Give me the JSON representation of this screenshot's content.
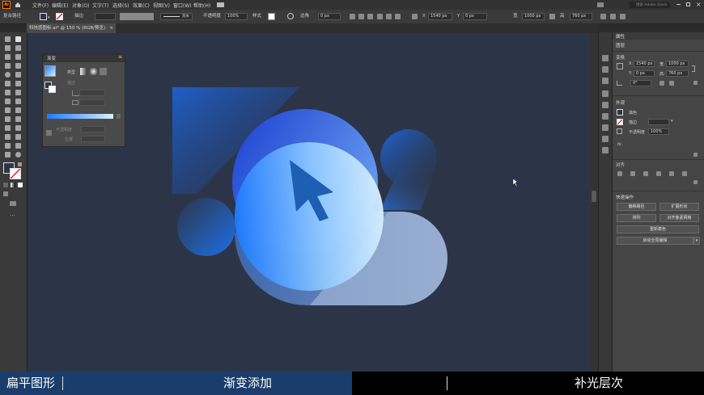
{
  "app": {
    "logo": "Ai"
  },
  "menu": [
    "文件(F)",
    "编辑(E)",
    "对象(O)",
    "文字(T)",
    "选择(S)",
    "效果(C)",
    "视图(V)",
    "窗口(W)",
    "帮助(H)"
  ],
  "window": {
    "search": "搜索 Adobe Stock"
  },
  "control_bar": {
    "selection_label": "复合路径",
    "stroke_label": "描边",
    "stroke_style": "基本",
    "opacity_label": "不透明度",
    "opacity_value": "100%",
    "style_label": "样式",
    "corner_label": "边角",
    "corner_value": "0 px",
    "x_label": "X",
    "x_value": "1540 px",
    "y_label": "Y",
    "y_value": "0 px",
    "w_label": "宽",
    "w_value": "1000 px",
    "h_label": "高",
    "h_value": "760 px"
  },
  "document_tab": {
    "title": "科技感图标.ai* @ 150 % (RGB/预览)",
    "close": "×"
  },
  "gradient_panel": {
    "title": "渐变",
    "type_label": "类型",
    "opacity_label": "不透明度",
    "position_label": "位置",
    "angle_icon": "angle-icon",
    "aspect_icon": "aspect-ratio-icon"
  },
  "properties_panel": {
    "title": "属性",
    "no_selection": "图层",
    "transform": {
      "title": "变换",
      "x_label": "X:",
      "x_value": "1540 px",
      "y_label": "Y:",
      "y_value": "0 px",
      "w_label": "宽:",
      "w_value": "1000 px",
      "h_label": "高:",
      "h_value": "760 px",
      "angle_value": "0°"
    },
    "appearance": {
      "title": "外观",
      "fill_label": "填色",
      "stroke_label": "描边",
      "opacity_label": "不透明度",
      "opacity_value": "100%",
      "fx_label": "fx."
    },
    "align": {
      "title": "对齐"
    },
    "quick_actions": {
      "title": "快速操作",
      "buttons": [
        "偏移路径",
        "扩展形状",
        "排列",
        "对齐像素网格",
        "重新着色",
        "启动全局编辑"
      ]
    }
  },
  "caption": {
    "left": "扁平图形",
    "middle": "渐变添加",
    "right": "补光层次"
  },
  "colors": {
    "canvas_bg": "#2c3548",
    "caption_blue": "#1b3d6b",
    "accent_blue": "#1e6fe0"
  }
}
